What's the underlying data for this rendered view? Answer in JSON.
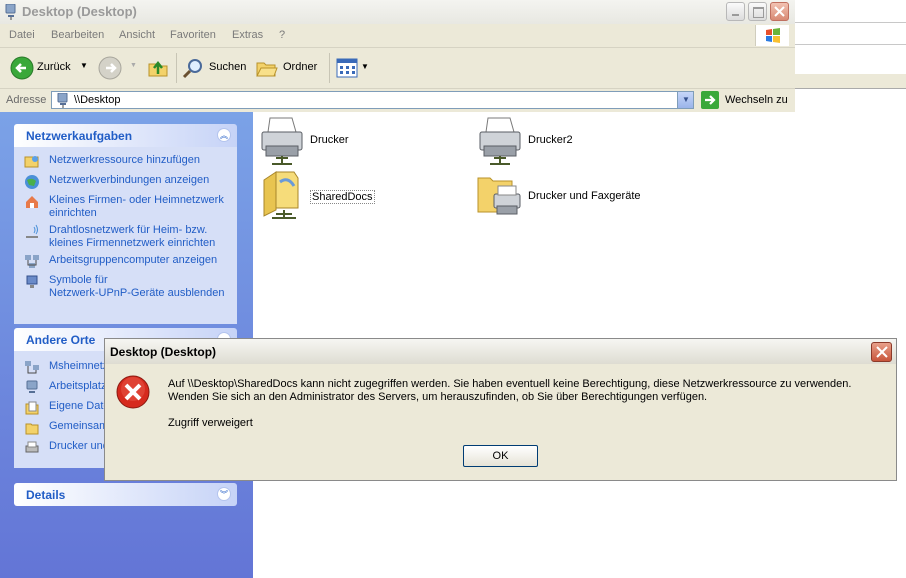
{
  "window": {
    "title": "Desktop (Desktop)"
  },
  "menu": {
    "items": [
      "Datei",
      "Bearbeiten",
      "Ansicht",
      "Favoriten",
      "Extras",
      "?"
    ]
  },
  "toolbar": {
    "back_label": "Zurück",
    "search_label": "Suchen",
    "folders_label": "Ordner"
  },
  "address": {
    "label": "Adresse",
    "value": "\\\\Desktop",
    "go_label": "Wechseln zu"
  },
  "tasks": {
    "network_title": "Netzwerkaufgaben",
    "network_items": [
      {
        "line1": "Netzwerkressource hinzufügen",
        "line2": ""
      },
      {
        "line1": "Netzwerkverbindungen anzeigen",
        "line2": ""
      },
      {
        "line1": "Kleines Firmen- oder Heimnetzwerk",
        "line2": "einrichten"
      },
      {
        "line1": "Drahtlosnetzwerk für Heim- bzw.",
        "line2": "kleines Firmennetzwerk einrichten"
      },
      {
        "line1": "Arbeitsgruppencomputer anzeigen",
        "line2": ""
      },
      {
        "line1": "Symbole für",
        "line2": "Netzwerk-UPnP-Geräte ausblenden"
      }
    ],
    "other_title": "Andere Orte",
    "other_items": [
      "Msheimnetz",
      "Arbeitsplatz",
      "Eigene Date",
      "Gemeinsam",
      "Drucker und"
    ],
    "details_title": "Details"
  },
  "content": {
    "items": [
      "Drucker",
      "Drucker2",
      "SharedDocs",
      "Drucker und Faxgeräte"
    ]
  },
  "dialog": {
    "title": "Desktop (Desktop)",
    "message": "Auf \\\\Desktop\\SharedDocs kann nicht zugegriffen werden. Sie haben eventuell keine Berechtigung, diese Netzwerkressource zu verwenden. Wenden Sie sich an den Administrator des Servers, um herauszufinden, ob Sie über Berechtigungen verfügen.",
    "detail": "Zugriff verweigert",
    "ok_label": "OK"
  },
  "colors": {
    "task_link": "#215dc6",
    "pane_gradient_top": "#7ba2e7",
    "error_red": "#d62a1e"
  }
}
